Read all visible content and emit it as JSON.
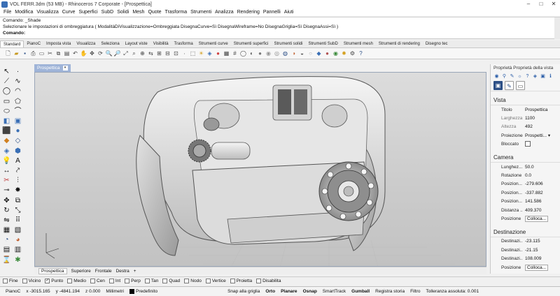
{
  "window": {
    "title": "VOL FERR.3dm (53 MB) - Rhinoceros 7 Corporate - [Prospettica]",
    "controls": [
      "–",
      "□",
      "✕"
    ]
  },
  "menu": [
    "File",
    "Modifica",
    "Visualizza",
    "Curve",
    "Superfici",
    "SubD",
    "Solidi",
    "Mesh",
    "Quote",
    "Trasforma",
    "Strumenti",
    "Analizza",
    "Rendering",
    "Pannelli",
    "Aiuti"
  ],
  "command": {
    "history1": "Comando: _Shade",
    "history2": "Selezionare le impostazioni di ombreggiatura ( ModalitàDiVisualizzazione=Ombreggiata  DisegnaCurve=Sì  DisegnaWireframe=No  DisegnaGriglia=Sì  DisegnaAssi=Sì )",
    "prompt": "Comando:"
  },
  "toolbar_tabs": [
    "Standard",
    "PianoC",
    "Imposta vista",
    "Visualizza",
    "Seleziona",
    "Layout viste",
    "Visibilità",
    "Trasforma",
    "Strumenti curve",
    "Strumenti superfici",
    "Strumenti solidi",
    "Strumenti SubD",
    "Strumenti mesh",
    "Strumenti di rendering",
    "Disegno tec"
  ],
  "viewport": {
    "name": "Prospettica"
  },
  "view_tabs": [
    "Prospettica",
    "Superiore",
    "Frontale",
    "Destra",
    "+"
  ],
  "osnap": [
    {
      "label": "Fine",
      "checked": false
    },
    {
      "label": "Vicino",
      "checked": false
    },
    {
      "label": "Punto",
      "checked": true
    },
    {
      "label": "Medio",
      "checked": false
    },
    {
      "label": "Cen",
      "checked": false
    },
    {
      "label": "Int",
      "checked": false
    },
    {
      "label": "Perp",
      "checked": false
    },
    {
      "label": "Tan",
      "checked": false
    },
    {
      "label": "Quad",
      "checked": false
    },
    {
      "label": "Nodo",
      "checked": false
    },
    {
      "label": "Vertice",
      "checked": false
    },
    {
      "label": "Proietta",
      "checked": false
    },
    {
      "label": "Disabilita",
      "checked": false
    }
  ],
  "status": {
    "plane": "PianoC",
    "x": "x -3015.165",
    "y": "y -4841.194",
    "z": "z 0.000",
    "units": "Millimetri",
    "layer": "Predefinito",
    "snap": "Snap alla griglia",
    "orto": "Orto",
    "planare": "Planare",
    "osnap": "Osnap",
    "smarttrack": "SmartTrack",
    "gumball": "Gumball",
    "history": "Registra storia",
    "filter": "Filtro",
    "tolerance": "Tolleranza assoluta: 0.001"
  },
  "properties": {
    "header": "Proprietà  Proprietà della vista",
    "vista_title": "Vista",
    "vista_rows": [
      {
        "k": "Titolo",
        "v": "Prospettica",
        "gray": false
      },
      {
        "k": "Larghezza",
        "v": "1100",
        "gray": true
      },
      {
        "k": "Altezza",
        "v": "492",
        "gray": true
      },
      {
        "k": "Proiezione",
        "v": "Prospetti... ▾",
        "gray": false
      }
    ],
    "bloccato": "Bloccato",
    "camera_title": "Camera",
    "camera_rows": [
      {
        "k": "Lunghez...",
        "v": "50.0"
      },
      {
        "k": "Rotazione",
        "v": "0.0"
      },
      {
        "k": "Posizion...",
        "v": "-279.606"
      },
      {
        "k": "Posizion...",
        "v": "-337.882"
      },
      {
        "k": "Posizion...",
        "v": "141.586"
      },
      {
        "k": "Distanza ...",
        "v": "409.370"
      }
    ],
    "posizione": "Posizione",
    "colloca": "Colloca...",
    "dest_title": "Destinazione",
    "dest_rows": [
      {
        "k": "Destinazi...",
        "v": "-23.115"
      },
      {
        "k": "Destinazi...",
        "v": "-21.15"
      },
      {
        "k": "Destinazi...",
        "v": "108.009"
      }
    ]
  }
}
